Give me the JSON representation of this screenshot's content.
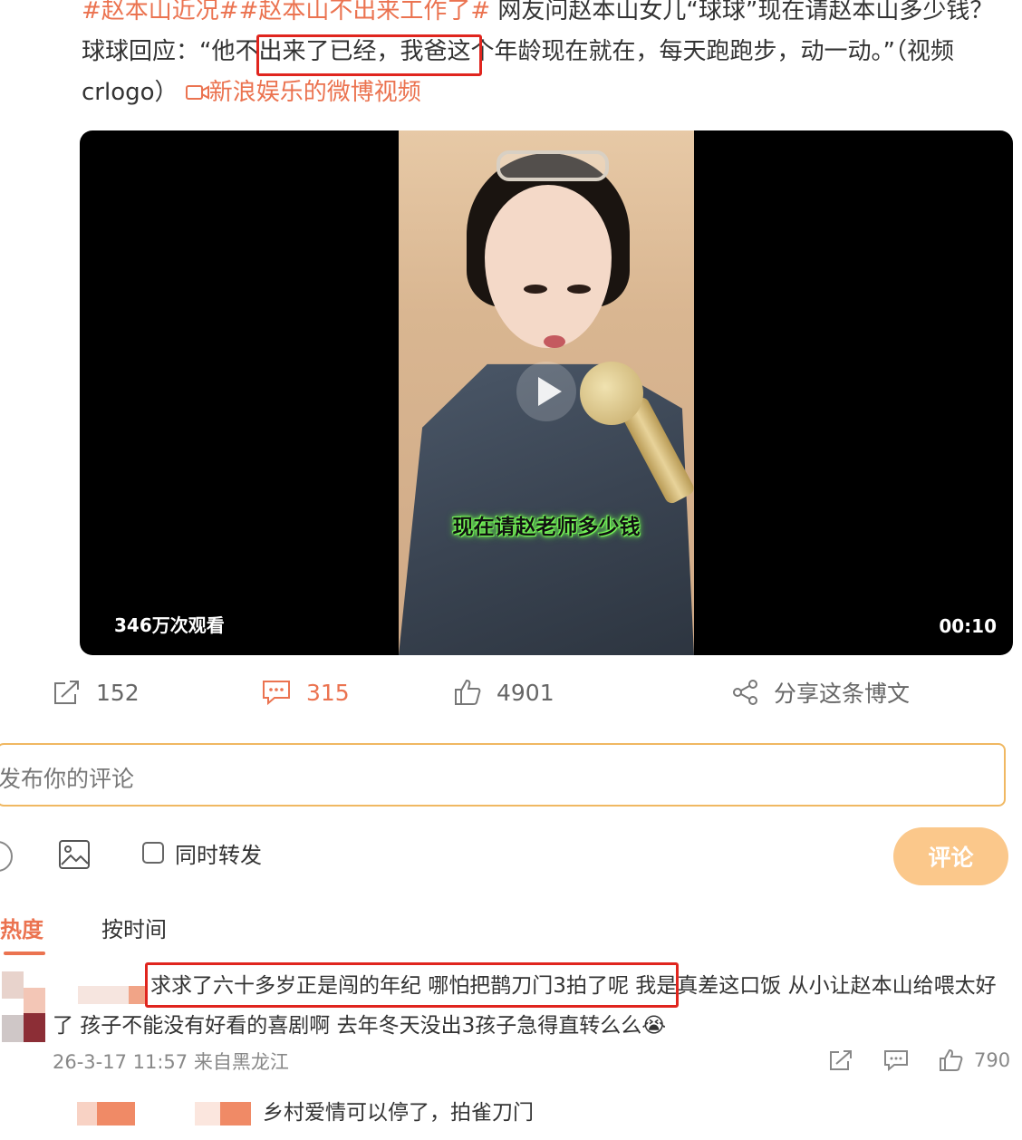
{
  "post": {
    "tag1": "#赵本山近况#",
    "tag2": "#赵本山不出来工作了#",
    "text_part1": " 网友问赵本山女儿“球球”现在请赵本山多少钱？球球回应：",
    "quote_highlight": "“他不出来了已经，",
    "text_part2": "我爸这个年龄现在就在，每天跑跑步，动一动。”（视频crlogo）",
    "video_link": "新浪娱乐的微博视频"
  },
  "video": {
    "subtitle": "现在请赵老师多少钱",
    "views": "346万次观看",
    "duration": "00:10"
  },
  "actions": {
    "reposts": "152",
    "comments": "315",
    "likes": "4901",
    "share_label": "分享这条博文"
  },
  "comment_box": {
    "placeholder": "发布你的评论",
    "sync_label": "同时转发",
    "submit_label": "评论"
  },
  "sort_tabs": {
    "hot": "热度",
    "time": "按时间"
  },
  "comments": [
    {
      "highlight": "求求了六十多岁正是闯的年纪 哪怕把鹊刀门3拍了呢",
      "rest": " 我是真差这口饭 从小让赵本山给喂太好了 孩子不能没有好看的喜剧啊 去年冬天没出3孩子急得直转么么😭",
      "meta": "26-3-17 11:57 来自黑龙江",
      "likes": "790"
    }
  ],
  "reply_preview": "乡村爱情可以停了，拍雀刀门",
  "colors": {
    "accent": "#eb7350",
    "highlight_box": "#e0251e",
    "submit_bg": "#fbc88b",
    "input_border": "#f0b862"
  },
  "icons": [
    "repost-icon",
    "comment-icon",
    "like-icon",
    "share-icon",
    "emoji-icon",
    "image-icon",
    "play-icon"
  ]
}
